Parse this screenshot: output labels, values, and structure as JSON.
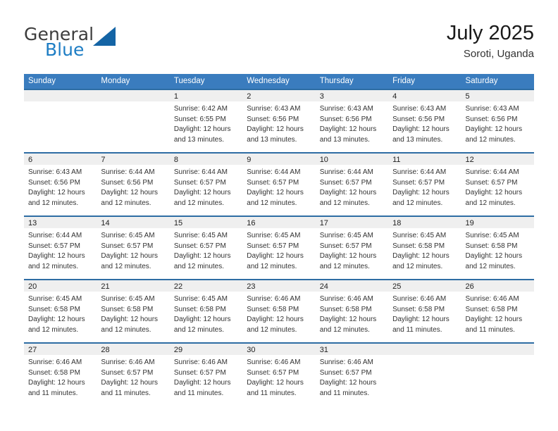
{
  "brand": {
    "name_part1": "General",
    "name_part2": "Blue",
    "logo_icon": "triangle-logo-icon",
    "accent_color": "#1d7dc4",
    "logo_color": "#1464a5"
  },
  "header": {
    "title": "July 2025",
    "subtitle": "Soroti, Uganda"
  },
  "calendar": {
    "header_background": "#3a7cbe",
    "row_border_color": "#2e6da4",
    "daynum_background": "#efefef",
    "weekdays": [
      "Sunday",
      "Monday",
      "Tuesday",
      "Wednesday",
      "Thursday",
      "Friday",
      "Saturday"
    ],
    "weeks": [
      [
        {
          "day": "",
          "sunrise": "",
          "sunset": "",
          "daylight_line1": "",
          "daylight_line2": ""
        },
        {
          "day": "",
          "sunrise": "",
          "sunset": "",
          "daylight_line1": "",
          "daylight_line2": ""
        },
        {
          "day": "1",
          "sunrise": "Sunrise: 6:42 AM",
          "sunset": "Sunset: 6:55 PM",
          "daylight_line1": "Daylight: 12 hours",
          "daylight_line2": "and 13 minutes."
        },
        {
          "day": "2",
          "sunrise": "Sunrise: 6:43 AM",
          "sunset": "Sunset: 6:56 PM",
          "daylight_line1": "Daylight: 12 hours",
          "daylight_line2": "and 13 minutes."
        },
        {
          "day": "3",
          "sunrise": "Sunrise: 6:43 AM",
          "sunset": "Sunset: 6:56 PM",
          "daylight_line1": "Daylight: 12 hours",
          "daylight_line2": "and 13 minutes."
        },
        {
          "day": "4",
          "sunrise": "Sunrise: 6:43 AM",
          "sunset": "Sunset: 6:56 PM",
          "daylight_line1": "Daylight: 12 hours",
          "daylight_line2": "and 13 minutes."
        },
        {
          "day": "5",
          "sunrise": "Sunrise: 6:43 AM",
          "sunset": "Sunset: 6:56 PM",
          "daylight_line1": "Daylight: 12 hours",
          "daylight_line2": "and 12 minutes."
        }
      ],
      [
        {
          "day": "6",
          "sunrise": "Sunrise: 6:43 AM",
          "sunset": "Sunset: 6:56 PM",
          "daylight_line1": "Daylight: 12 hours",
          "daylight_line2": "and 12 minutes."
        },
        {
          "day": "7",
          "sunrise": "Sunrise: 6:44 AM",
          "sunset": "Sunset: 6:56 PM",
          "daylight_line1": "Daylight: 12 hours",
          "daylight_line2": "and 12 minutes."
        },
        {
          "day": "8",
          "sunrise": "Sunrise: 6:44 AM",
          "sunset": "Sunset: 6:57 PM",
          "daylight_line1": "Daylight: 12 hours",
          "daylight_line2": "and 12 minutes."
        },
        {
          "day": "9",
          "sunrise": "Sunrise: 6:44 AM",
          "sunset": "Sunset: 6:57 PM",
          "daylight_line1": "Daylight: 12 hours",
          "daylight_line2": "and 12 minutes."
        },
        {
          "day": "10",
          "sunrise": "Sunrise: 6:44 AM",
          "sunset": "Sunset: 6:57 PM",
          "daylight_line1": "Daylight: 12 hours",
          "daylight_line2": "and 12 minutes."
        },
        {
          "day": "11",
          "sunrise": "Sunrise: 6:44 AM",
          "sunset": "Sunset: 6:57 PM",
          "daylight_line1": "Daylight: 12 hours",
          "daylight_line2": "and 12 minutes."
        },
        {
          "day": "12",
          "sunrise": "Sunrise: 6:44 AM",
          "sunset": "Sunset: 6:57 PM",
          "daylight_line1": "Daylight: 12 hours",
          "daylight_line2": "and 12 minutes."
        }
      ],
      [
        {
          "day": "13",
          "sunrise": "Sunrise: 6:44 AM",
          "sunset": "Sunset: 6:57 PM",
          "daylight_line1": "Daylight: 12 hours",
          "daylight_line2": "and 12 minutes."
        },
        {
          "day": "14",
          "sunrise": "Sunrise: 6:45 AM",
          "sunset": "Sunset: 6:57 PM",
          "daylight_line1": "Daylight: 12 hours",
          "daylight_line2": "and 12 minutes."
        },
        {
          "day": "15",
          "sunrise": "Sunrise: 6:45 AM",
          "sunset": "Sunset: 6:57 PM",
          "daylight_line1": "Daylight: 12 hours",
          "daylight_line2": "and 12 minutes."
        },
        {
          "day": "16",
          "sunrise": "Sunrise: 6:45 AM",
          "sunset": "Sunset: 6:57 PM",
          "daylight_line1": "Daylight: 12 hours",
          "daylight_line2": "and 12 minutes."
        },
        {
          "day": "17",
          "sunrise": "Sunrise: 6:45 AM",
          "sunset": "Sunset: 6:57 PM",
          "daylight_line1": "Daylight: 12 hours",
          "daylight_line2": "and 12 minutes."
        },
        {
          "day": "18",
          "sunrise": "Sunrise: 6:45 AM",
          "sunset": "Sunset: 6:58 PM",
          "daylight_line1": "Daylight: 12 hours",
          "daylight_line2": "and 12 minutes."
        },
        {
          "day": "19",
          "sunrise": "Sunrise: 6:45 AM",
          "sunset": "Sunset: 6:58 PM",
          "daylight_line1": "Daylight: 12 hours",
          "daylight_line2": "and 12 minutes."
        }
      ],
      [
        {
          "day": "20",
          "sunrise": "Sunrise: 6:45 AM",
          "sunset": "Sunset: 6:58 PM",
          "daylight_line1": "Daylight: 12 hours",
          "daylight_line2": "and 12 minutes."
        },
        {
          "day": "21",
          "sunrise": "Sunrise: 6:45 AM",
          "sunset": "Sunset: 6:58 PM",
          "daylight_line1": "Daylight: 12 hours",
          "daylight_line2": "and 12 minutes."
        },
        {
          "day": "22",
          "sunrise": "Sunrise: 6:45 AM",
          "sunset": "Sunset: 6:58 PM",
          "daylight_line1": "Daylight: 12 hours",
          "daylight_line2": "and 12 minutes."
        },
        {
          "day": "23",
          "sunrise": "Sunrise: 6:46 AM",
          "sunset": "Sunset: 6:58 PM",
          "daylight_line1": "Daylight: 12 hours",
          "daylight_line2": "and 12 minutes."
        },
        {
          "day": "24",
          "sunrise": "Sunrise: 6:46 AM",
          "sunset": "Sunset: 6:58 PM",
          "daylight_line1": "Daylight: 12 hours",
          "daylight_line2": "and 12 minutes."
        },
        {
          "day": "25",
          "sunrise": "Sunrise: 6:46 AM",
          "sunset": "Sunset: 6:58 PM",
          "daylight_line1": "Daylight: 12 hours",
          "daylight_line2": "and 11 minutes."
        },
        {
          "day": "26",
          "sunrise": "Sunrise: 6:46 AM",
          "sunset": "Sunset: 6:58 PM",
          "daylight_line1": "Daylight: 12 hours",
          "daylight_line2": "and 11 minutes."
        }
      ],
      [
        {
          "day": "27",
          "sunrise": "Sunrise: 6:46 AM",
          "sunset": "Sunset: 6:58 PM",
          "daylight_line1": "Daylight: 12 hours",
          "daylight_line2": "and 11 minutes."
        },
        {
          "day": "28",
          "sunrise": "Sunrise: 6:46 AM",
          "sunset": "Sunset: 6:57 PM",
          "daylight_line1": "Daylight: 12 hours",
          "daylight_line2": "and 11 minutes."
        },
        {
          "day": "29",
          "sunrise": "Sunrise: 6:46 AM",
          "sunset": "Sunset: 6:57 PM",
          "daylight_line1": "Daylight: 12 hours",
          "daylight_line2": "and 11 minutes."
        },
        {
          "day": "30",
          "sunrise": "Sunrise: 6:46 AM",
          "sunset": "Sunset: 6:57 PM",
          "daylight_line1": "Daylight: 12 hours",
          "daylight_line2": "and 11 minutes."
        },
        {
          "day": "31",
          "sunrise": "Sunrise: 6:46 AM",
          "sunset": "Sunset: 6:57 PM",
          "daylight_line1": "Daylight: 12 hours",
          "daylight_line2": "and 11 minutes."
        },
        {
          "day": "",
          "sunrise": "",
          "sunset": "",
          "daylight_line1": "",
          "daylight_line2": ""
        },
        {
          "day": "",
          "sunrise": "",
          "sunset": "",
          "daylight_line1": "",
          "daylight_line2": ""
        }
      ]
    ]
  }
}
